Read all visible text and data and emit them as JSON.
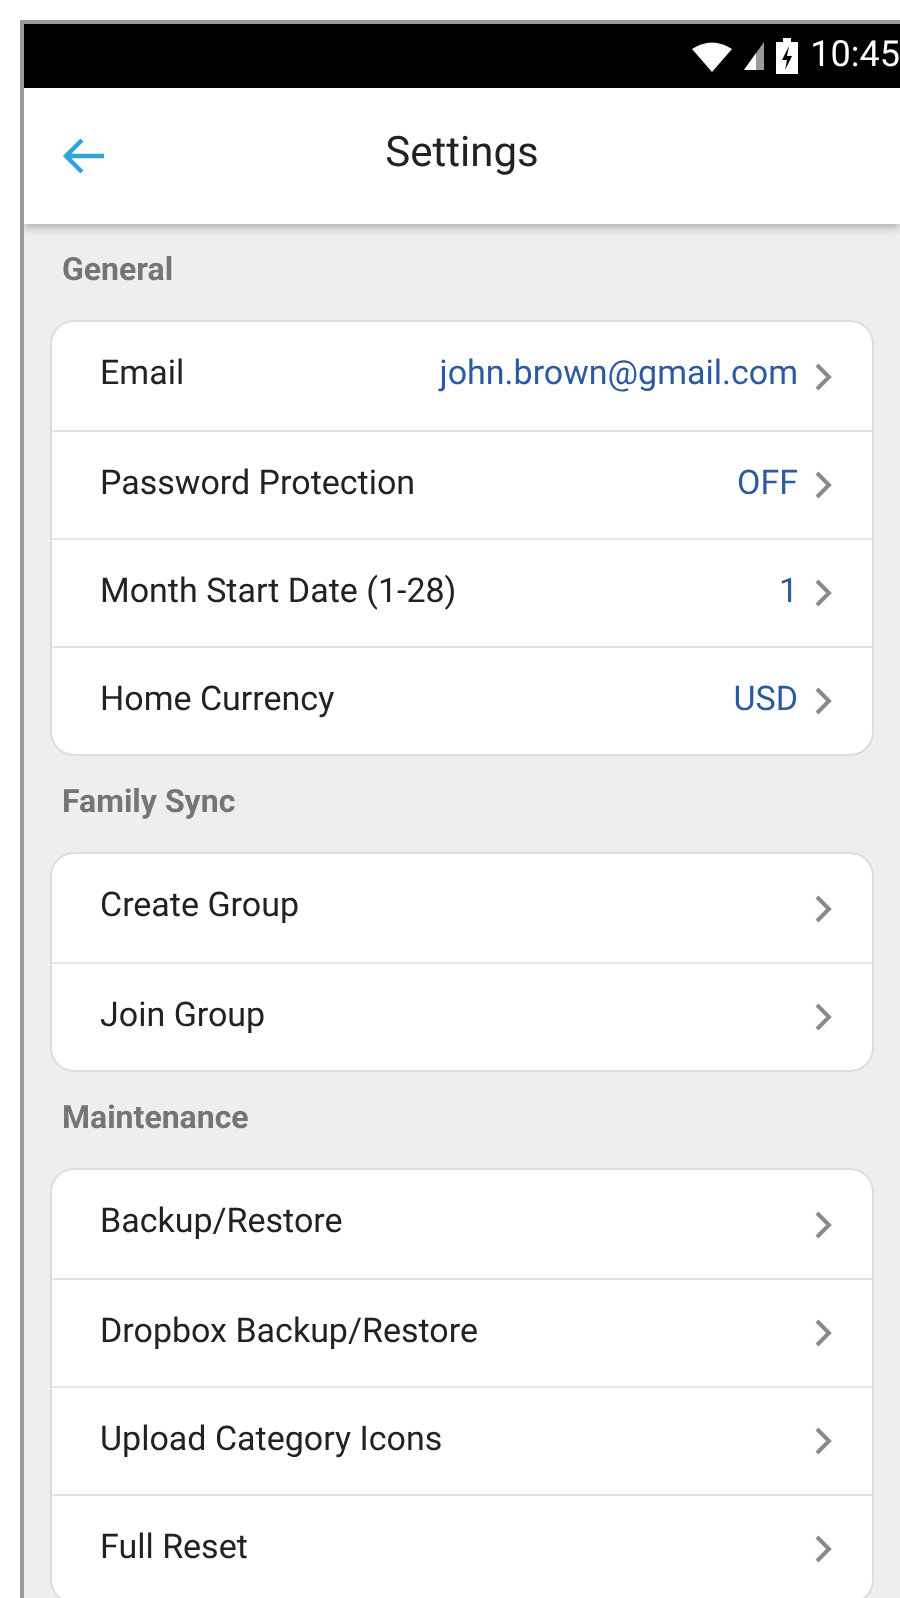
{
  "status_bar": {
    "time": "10:45"
  },
  "app_bar": {
    "title": "Settings"
  },
  "sections": [
    {
      "title": "General",
      "items": [
        {
          "label": "Email",
          "value": "john.brown@gmail.com"
        },
        {
          "label": "Password Protection",
          "value": "OFF"
        },
        {
          "label": "Month Start Date (1-28)",
          "value": "1"
        },
        {
          "label": "Home Currency",
          "value": "USD"
        }
      ]
    },
    {
      "title": "Family Sync",
      "items": [
        {
          "label": "Create Group"
        },
        {
          "label": "Join Group"
        }
      ]
    },
    {
      "title": "Maintenance",
      "items": [
        {
          "label": "Backup/Restore"
        },
        {
          "label": "Dropbox Backup/Restore"
        },
        {
          "label": "Upload Category Icons"
        },
        {
          "label": "Full Reset"
        }
      ]
    }
  ]
}
